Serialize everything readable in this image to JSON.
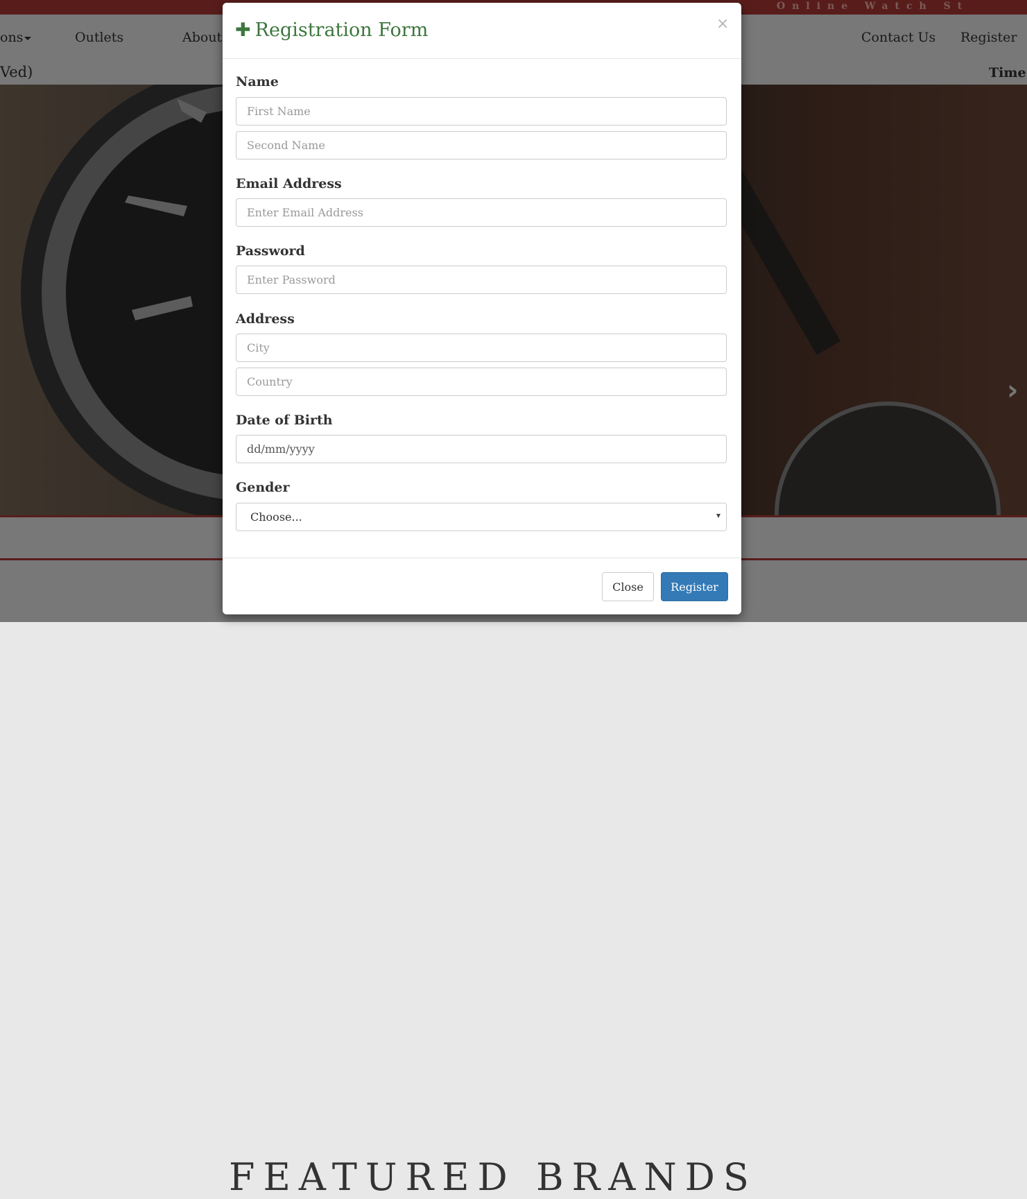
{
  "background": {
    "marquee": "Online Watch St",
    "nav": {
      "collections": "ons",
      "outlets": "Outlets",
      "about": "About",
      "contact": "Contact Us",
      "register": "Register"
    },
    "date_fragment": "Ved)",
    "time_label": "Time:",
    "section_heading": "FEATURED BRANDS",
    "next_arrow": "›"
  },
  "modal": {
    "title": "Registration Form",
    "title_icon": "plus-icon",
    "close_symbol": "×",
    "fields": {
      "name_label": "Name",
      "first_name_placeholder": "First Name",
      "second_name_placeholder": "Second Name",
      "email_label": "Email Address",
      "email_placeholder": "Enter Email Address",
      "password_label": "Password",
      "password_placeholder": "Enter Password",
      "address_label": "Address",
      "city_placeholder": "City",
      "country_placeholder": "Country",
      "dob_label": "Date of Birth",
      "dob_value": "dd/mm/yyyy",
      "gender_label": "Gender",
      "gender_selected": "Choose..."
    },
    "buttons": {
      "close": "Close",
      "register": "Register"
    }
  },
  "colors": {
    "accent_red": "#b03a36",
    "title_green": "#3c763d",
    "primary_blue": "#337ab7"
  }
}
